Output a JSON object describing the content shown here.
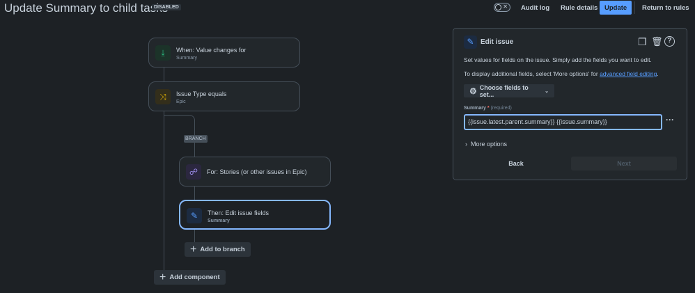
{
  "header": {
    "title": "Update Summary to child tasks",
    "status_badge": "DISABLED",
    "toggle_symbol": "✕",
    "audit_log": "Audit log",
    "rule_details": "Rule details",
    "update": "Update",
    "return": "Return to rules"
  },
  "flow": {
    "trigger": {
      "title": "When: Value changes for",
      "subtitle": "Summary",
      "icon": "trigger-icon",
      "color": "#2abb7f"
    },
    "condition": {
      "title": "Issue Type equals",
      "subtitle": "Epic",
      "icon": "shuffle-icon",
      "color": "#e2b203"
    },
    "branch_label": "BRANCH",
    "branch": {
      "title": "For: Stories (or other issues in Epic)",
      "icon": "hierarchy-icon",
      "color": "#9f8fef"
    },
    "action": {
      "title": "Then: Edit issue fields",
      "subtitle": "Summary",
      "icon": "pencil-icon",
      "color": "#579dff"
    },
    "add_to_branch": "Add to branch",
    "add_component": "Add component"
  },
  "panel": {
    "title": "Edit issue",
    "desc1": "Set values for fields on the issue. Simply add the fields you want to edit.",
    "desc2_prefix": "To display additional fields, select 'More options' for ",
    "desc2_link": "advanced field editing",
    "desc2_suffix": ".",
    "choose_fields": "Choose fields to set...",
    "field_label": "Summary",
    "required_mark": "*",
    "required_hint": "(required)",
    "field_value": "{{issue.latest.parent.summary}} {{issue.summary}}",
    "more_options": "More options",
    "back": "Back",
    "next": "Next"
  }
}
